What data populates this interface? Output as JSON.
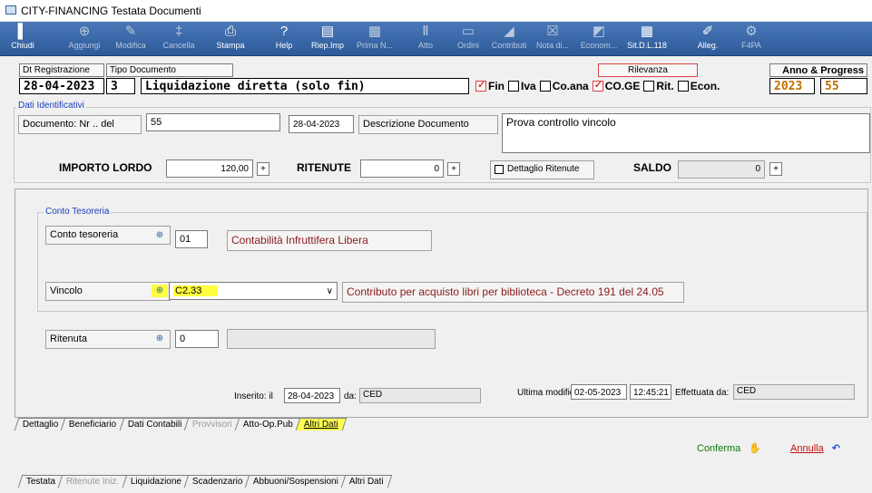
{
  "window": {
    "title": "CITY-FINANCING  Testata Documenti"
  },
  "toolbar": [
    {
      "label": "Chiudi",
      "icon": "exit-icon",
      "enabled": true
    },
    {
      "label": "Aggiungi",
      "icon": "add-icon",
      "enabled": false
    },
    {
      "label": "Modifica",
      "icon": "edit-icon",
      "enabled": false
    },
    {
      "label": "Cancella",
      "icon": "delete-icon",
      "enabled": false
    },
    {
      "label": "Stampa",
      "icon": "print-icon",
      "enabled": true
    },
    {
      "label": "Help",
      "icon": "help-icon",
      "enabled": true
    },
    {
      "label": "Riep.Imp",
      "icon": "book-icon",
      "enabled": true
    },
    {
      "label": "Prima N...",
      "icon": "note-icon",
      "enabled": false
    },
    {
      "label": "Atto",
      "icon": "act-icon",
      "enabled": false
    },
    {
      "label": "Ordini",
      "icon": "orders-icon",
      "enabled": false
    },
    {
      "label": "Contributi",
      "icon": "contributions-icon",
      "enabled": false
    },
    {
      "label": "Nota di...",
      "icon": "credit-note-icon",
      "enabled": false
    },
    {
      "label": "Econom...",
      "icon": "economy-icon",
      "enabled": false
    },
    {
      "label": "Sit.D.L.118",
      "icon": "report-icon",
      "enabled": true
    },
    {
      "label": "Alleg.",
      "icon": "attach-icon",
      "enabled": true
    },
    {
      "label": "F4PA",
      "icon": "f4pa-icon",
      "enabled": false
    }
  ],
  "header": {
    "dt_label": "Dt Registrazione",
    "tipo_label": "Tipo Documento",
    "date": "28-04-2023",
    "tipo_code": "3",
    "tipo_desc": "Liquidazione diretta  (solo fin)",
    "rilevanza_label": "Rilevanza",
    "anno_label": "Anno & Progress",
    "anno": "2023",
    "progress": "55",
    "flags": [
      {
        "label": "Fin",
        "checked": true
      },
      {
        "label": "Iva",
        "checked": false
      },
      {
        "label": "Co.ana",
        "checked": false
      },
      {
        "label": "CO.GE",
        "checked": true
      },
      {
        "label": "Rit.",
        "checked": false
      },
      {
        "label": "Econ.",
        "checked": false
      }
    ]
  },
  "dati": {
    "group_title": "Dati Identificativi",
    "doc_label": "Documento: Nr .. del",
    "doc_nr": "55",
    "doc_date": "28-04-2023",
    "desc_label": "Descrizione Documento",
    "desc": "Prova controllo vincolo",
    "importo_label": "IMPORTO LORDO",
    "importo": "120,00",
    "ritenute_label": "RITENUTE",
    "ritenute": "0",
    "dettaglio_label": "Dettaglio Ritenute",
    "saldo_label": "SALDO",
    "saldo": "0",
    "plus": "+"
  },
  "conto": {
    "group_title": "Conto Tesoreria",
    "conto_label": "Conto tesoreria",
    "conto_code": "01",
    "conto_desc": "Contabilità Infruttifera Libera",
    "vincolo_label": "Vincolo",
    "vincolo_code": "C2.33",
    "vincolo_desc": "Contributo per acquisto libri per biblioteca - Decreto 191 del 24.05",
    "ritenuta_label": "Ritenuta",
    "ritenuta_code": "0"
  },
  "audit": {
    "inserito_label": "Inserito:  il",
    "inserito_date": "28-04-2023",
    "da_label": "da:",
    "inserito_by": "CED",
    "modifica_label": "Ultima modifica:",
    "modifica_date": "02-05-2023",
    "modifica_time": "12:45:21",
    "effettuata_label": "Effettuata da:",
    "modifica_by": "CED"
  },
  "inner_tabs": [
    {
      "label": "Dettaglio",
      "state": "normal"
    },
    {
      "label": "Beneficiario",
      "state": "normal"
    },
    {
      "label": "Dati Contabili",
      "state": "normal"
    },
    {
      "label": "Provvisori",
      "state": "disabled"
    },
    {
      "label": "Atto-Op.Pub",
      "state": "normal"
    },
    {
      "label": "Altri Dati",
      "state": "active"
    }
  ],
  "actions": {
    "confirm": "Conferma",
    "cancel": "Annulla"
  },
  "bottom_tabs": [
    {
      "label": "Testata",
      "state": "normal"
    },
    {
      "label": "Ritenute Iniz.",
      "state": "disabled"
    },
    {
      "label": "Liquidazione",
      "state": "normal"
    },
    {
      "label": "Scadenzario",
      "state": "normal"
    },
    {
      "label": "Abbuoni/Sospensioni",
      "state": "normal"
    },
    {
      "label": "Altri Dati",
      "state": "normal"
    }
  ]
}
